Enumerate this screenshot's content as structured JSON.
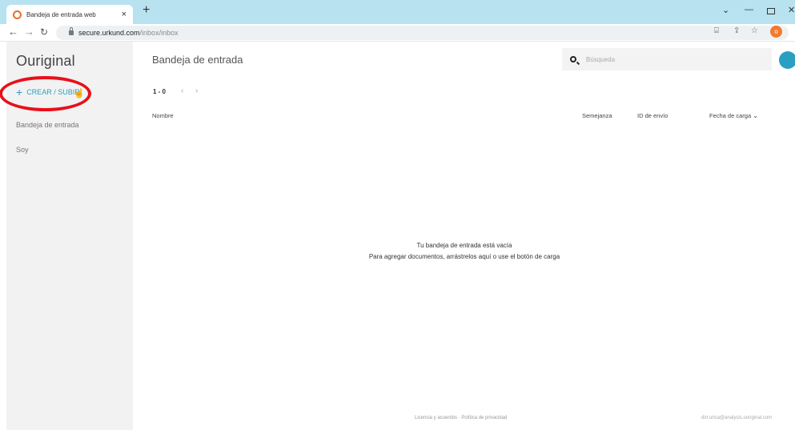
{
  "browser": {
    "tab_title": "Bandeja de entrada web",
    "tab_close": "×",
    "new_tab": "+",
    "url_domain": "secure.urkund.com",
    "url_path": "/inbox/inbox",
    "profile_initial": "o"
  },
  "sidebar": {
    "logo": "Ouriginal",
    "create_label": "CREAR / SUBIR",
    "items": [
      {
        "label": "Bandeja de entrada"
      },
      {
        "label": "Soy"
      }
    ]
  },
  "header": {
    "title": "Bandeja de entrada",
    "search_placeholder": "Búsqueda"
  },
  "pager": {
    "range": "1 - 0",
    "prev": "‹",
    "next": "›"
  },
  "table": {
    "columns": [
      "Nombre",
      "Semejanza",
      "ID de envío",
      "Fecha de carga"
    ]
  },
  "empty_state": {
    "title": "Tu bandeja de entrada está vacía",
    "subtitle": "Para agregar documentos, arrástrelos aquí o use el botón de carga"
  },
  "footer": {
    "links": "Licencia y acuerdos · Política de privacidad",
    "email": "dirr.urica@analysis.ouriginal.com"
  },
  "colors": {
    "accent": "#2a9fc2",
    "annotation": "#e8101a",
    "browser_tabbar": "#b8e2f0"
  }
}
